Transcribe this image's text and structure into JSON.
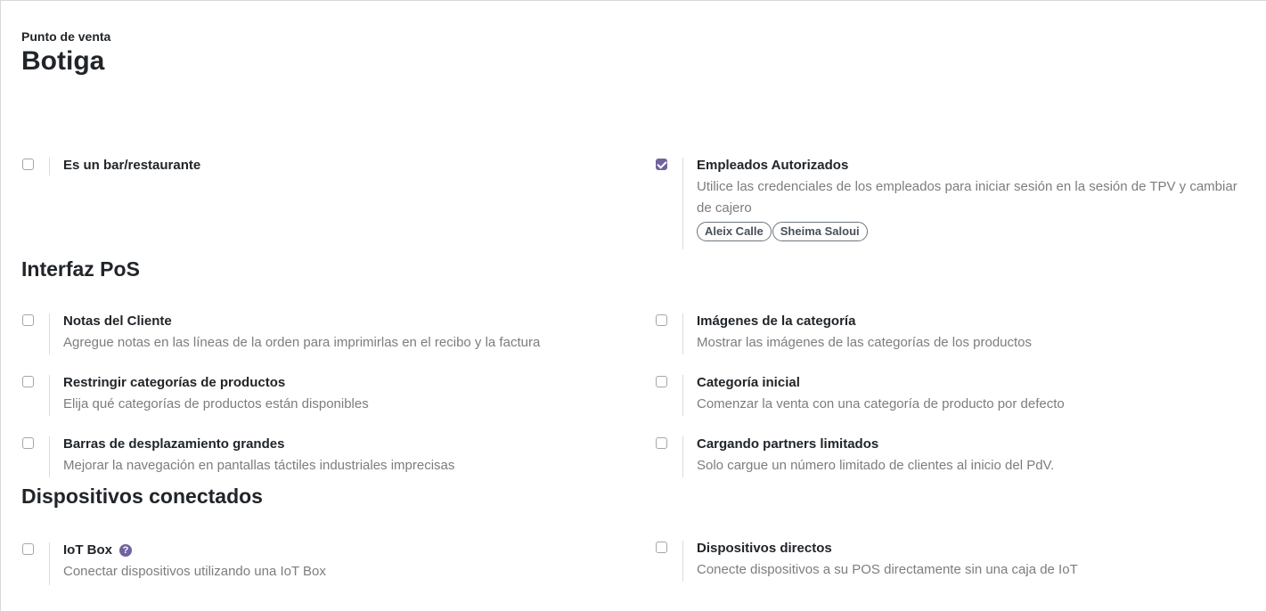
{
  "breadcrumb": "Punto de venta",
  "title": "Botiga",
  "general": {
    "bar_restaurant": {
      "label": "Es un bar/restaurante",
      "checked": false
    },
    "authorized_employees": {
      "label": "Empleados Autorizados",
      "desc": "Utilice las credenciales de los empleados para iniciar sesión en la sesión de TPV y cambiar de cajero",
      "checked": true,
      "tags": [
        "Aleix Calle",
        "Sheima Saloui"
      ]
    }
  },
  "sections": {
    "interface": "Interfaz PoS",
    "devices": "Dispositivos conectados"
  },
  "interface": {
    "customer_notes": {
      "label": "Notas del Cliente",
      "desc": "Agregue notas en las líneas de la orden para imprimirlas en el recibo y la factura"
    },
    "category_images": {
      "label": "Imágenes de la categoría",
      "desc": "Mostrar las imágenes de las categorías de los productos"
    },
    "restrict_categories": {
      "label": "Restringir categorías de productos",
      "desc": "Elija qué categorías de productos están disponibles"
    },
    "start_category": {
      "label": "Categoría inicial",
      "desc": "Comenzar la venta con una categoría de producto por defecto"
    },
    "large_scrollbars": {
      "label": "Barras de desplazamiento grandes",
      "desc": "Mejorar la navegación en pantallas táctiles industriales imprecisas"
    },
    "limited_partners": {
      "label": "Cargando partners limitados",
      "desc": "Solo cargue un número limitado de clientes al inicio del PdV."
    }
  },
  "devices": {
    "iot_box": {
      "label": "IoT Box",
      "desc": "Conectar dispositivos utilizando una IoT Box",
      "help": "?"
    },
    "direct_devices": {
      "label": "Dispositivos directos",
      "desc": "Conecte dispositivos a su POS directamente sin una caja de IoT"
    }
  },
  "colors": {
    "accent": "#71639e",
    "muted_text": "#7d7d7d"
  }
}
